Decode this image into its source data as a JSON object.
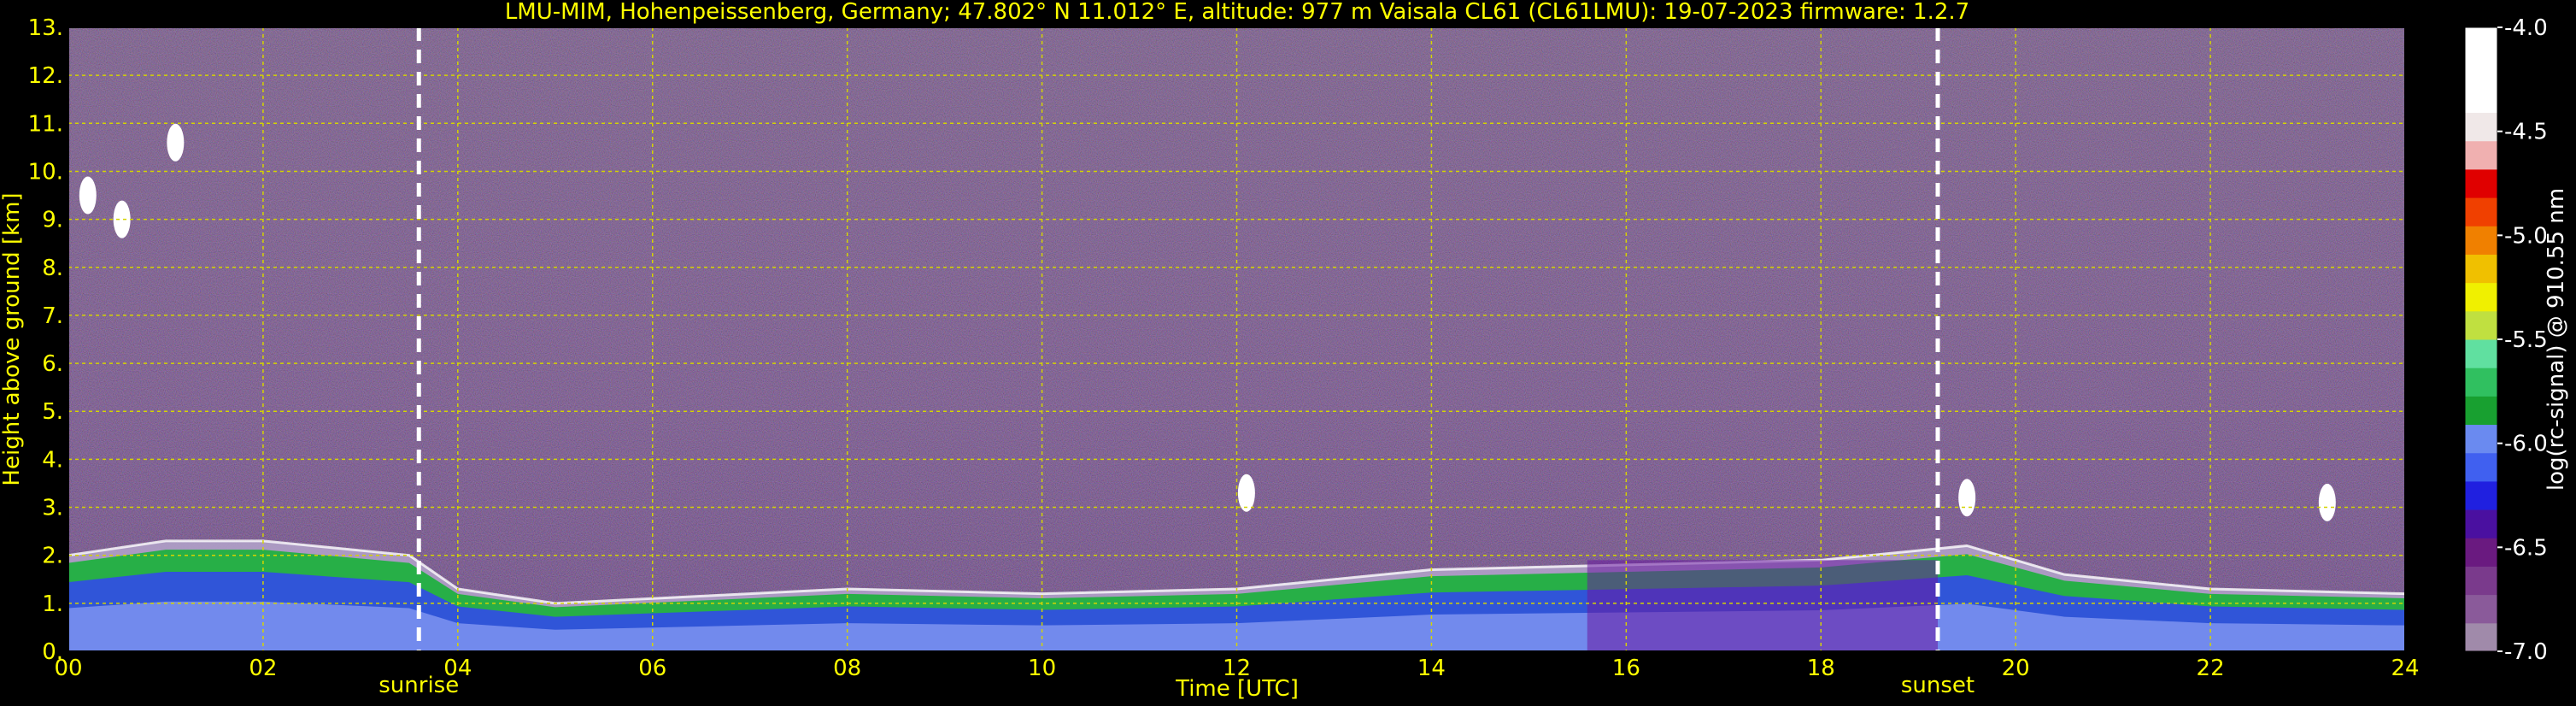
{
  "chart_data": {
    "type": "heatmap",
    "title": "LMU-MIM, Hohenpeissenberg, Germany; 47.802° N 11.012° E, altitude: 977 m    Vaisala CL61 (CL61LMU): 19-07-2023    firmware: 1.2.7",
    "xlabel": "Time [UTC]",
    "ylabel": "Height above ground [km]",
    "xlim": [
      0,
      24
    ],
    "ylim": [
      0,
      13
    ],
    "x_ticks": [
      "00",
      "02",
      "04",
      "06",
      "08",
      "10",
      "12",
      "14",
      "16",
      "18",
      "20",
      "22",
      "24"
    ],
    "y_ticks": [
      "0.",
      "1.",
      "2.",
      "3.",
      "4.",
      "5.",
      "6.",
      "7.",
      "8.",
      "9.",
      "10.",
      "11.",
      "12.",
      "13."
    ],
    "grid": true,
    "sunrise": {
      "label": "sunrise",
      "time": 3.6
    },
    "sunset": {
      "label": "sunset",
      "time": 19.2
    },
    "colorbar": {
      "label": "log(rc-signal) @ 910.55 nm",
      "range": [
        -7.0,
        -4.0
      ],
      "ticks": [
        "-4.0",
        "-4.5",
        "-5.0",
        "-5.5",
        "-6.0",
        "-6.5",
        "-7.0"
      ]
    },
    "boundary_layer_top_km": [
      [
        0.0,
        2.0
      ],
      [
        1.0,
        2.3
      ],
      [
        2.0,
        2.3
      ],
      [
        3.5,
        2.0
      ],
      [
        4.0,
        1.3
      ],
      [
        5.0,
        1.0
      ],
      [
        6.0,
        1.1
      ],
      [
        8.0,
        1.3
      ],
      [
        10.0,
        1.2
      ],
      [
        12.0,
        1.3
      ],
      [
        14.0,
        1.7
      ],
      [
        16.0,
        1.8
      ],
      [
        18.0,
        1.9
      ],
      [
        19.5,
        2.2
      ],
      [
        20.5,
        1.6
      ],
      [
        22.0,
        1.3
      ],
      [
        24.0,
        1.2
      ]
    ],
    "cloud_patches_km": [
      {
        "time": 1.1,
        "height": 10.6
      },
      {
        "time": 0.2,
        "height": 9.5
      },
      {
        "time": 0.55,
        "height": 9.0
      },
      {
        "time": 12.1,
        "height": 3.3
      },
      {
        "time": 19.5,
        "height": 3.2
      },
      {
        "time": 23.2,
        "height": 3.1
      }
    ],
    "colors": {
      "text": "#ffff00",
      "grid": "#d4d400",
      "background": "#000000",
      "noise": "#5a3a6a"
    }
  }
}
